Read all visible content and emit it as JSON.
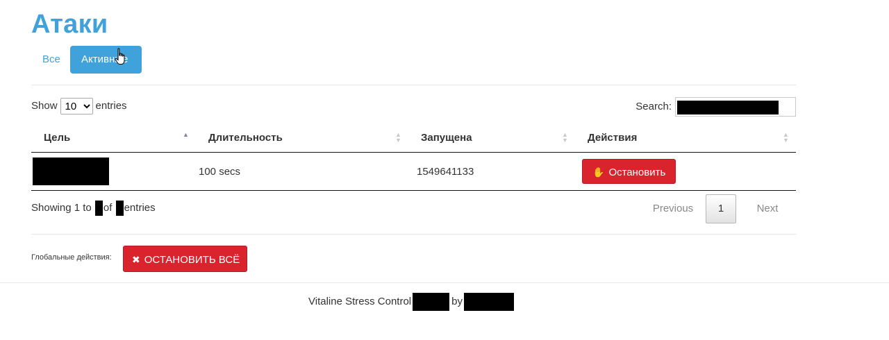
{
  "page": {
    "title": "Атаки"
  },
  "tabs": [
    {
      "label": "Все",
      "active": false
    },
    {
      "label": "Активные",
      "active": true
    }
  ],
  "table_controls": {
    "show_label": "Show",
    "length_value": "10",
    "entries_label": "entries",
    "search_label": "Search:"
  },
  "table": {
    "columns": [
      "Цель",
      "Длительность",
      "Запущена",
      "Действия"
    ],
    "sorted_column": "Цель",
    "sort_direction": "asc",
    "rows": [
      {
        "target": "",
        "duration": "100 secs",
        "started": "1549641133",
        "action_label": "Остановить",
        "action_icon": "hand-stop-icon"
      }
    ]
  },
  "info": {
    "showing_prefix": "Showing 1 to",
    "of_label": "of",
    "entries_label": "entries"
  },
  "pagination": {
    "previous": "Previous",
    "current_page": "1",
    "next": "Next"
  },
  "global_actions": {
    "label": "Глобальные действия:",
    "stop_all_label": "ОСТАНОВИТЬ ВСЁ",
    "stop_all_icon": "pin-off-icon"
  },
  "footer": {
    "text": "Vitaline Stress Control",
    "by_label": "by"
  },
  "colors": {
    "accent": "#3fa2db",
    "danger": "#d9232d"
  }
}
